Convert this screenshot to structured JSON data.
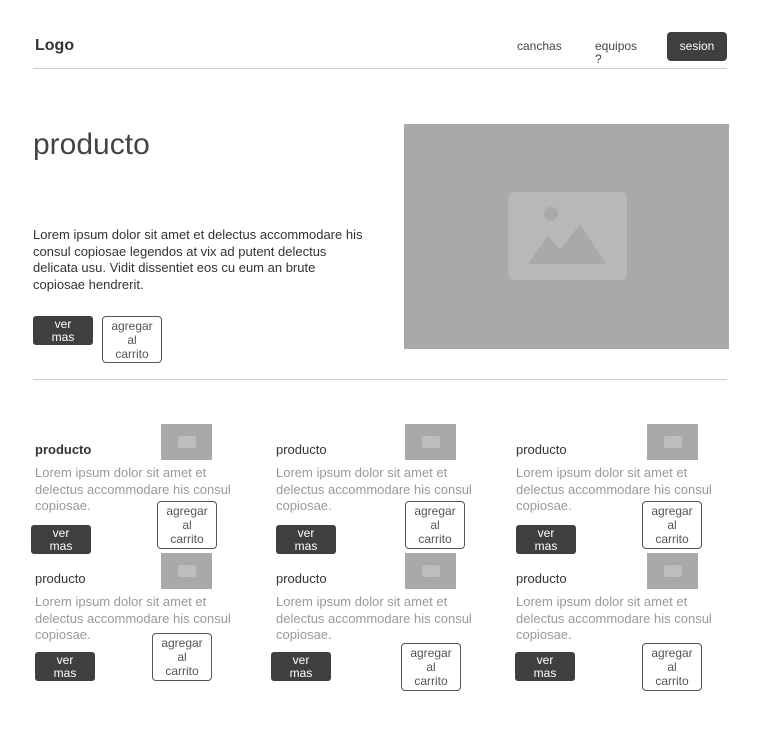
{
  "header": {
    "logo": "Logo",
    "nav": {
      "canchas": "canchas",
      "equipos": "equipos\n?",
      "sesion": "sesion"
    }
  },
  "hero": {
    "title": "producto",
    "text": "Lorem ipsum dolor sit amet et delectus accommodare his consul copiosae legendos at vix ad putent delectus delicata usu. Vidit dissentiet eos cu eum an brute copiosae hendrerit.",
    "ver_mas": "ver\nmas",
    "agregar": "agregar\nal\ncarrito"
  },
  "cards": [
    {
      "title": "producto",
      "text": "Lorem ipsum dolor sit amet et delectus accommodare his consul copiosae.",
      "ver_mas": "ver\nmas",
      "agregar": "agregar\nal\ncarrito"
    },
    {
      "title": "producto",
      "text": "Lorem ipsum dolor sit amet et delectus accommodare his consul copiosae.",
      "ver_mas": "ver\nmas",
      "agregar": "agregar\nal\ncarrito"
    },
    {
      "title": "producto",
      "text": "Lorem ipsum dolor sit amet et delectus accommodare his consul copiosae.",
      "ver_mas": "ver\nmas",
      "agregar": "agregar\nal\ncarrito"
    },
    {
      "title": "producto",
      "text": "Lorem ipsum dolor sit amet et delectus accommodare his consul copiosae.",
      "ver_mas": "ver\nmas",
      "agregar": "agregar\nal\ncarrito"
    },
    {
      "title": "producto",
      "text": "Lorem ipsum dolor sit amet et delectus accommodare his consul copiosae.",
      "ver_mas": "ver\nmas",
      "agregar": "agregar\nal\ncarrito"
    },
    {
      "title": "producto",
      "text": "Lorem ipsum dolor sit amet et delectus accommodare his consul copiosae.",
      "ver_mas": "ver\nmas",
      "agregar": "agregar\nal\ncarrito"
    }
  ],
  "icons": {
    "placeholder": "image-placeholder-icon"
  },
  "colors": {
    "dark_button": "#3f3f3f",
    "image_placeholder": "#a9a9a9"
  }
}
